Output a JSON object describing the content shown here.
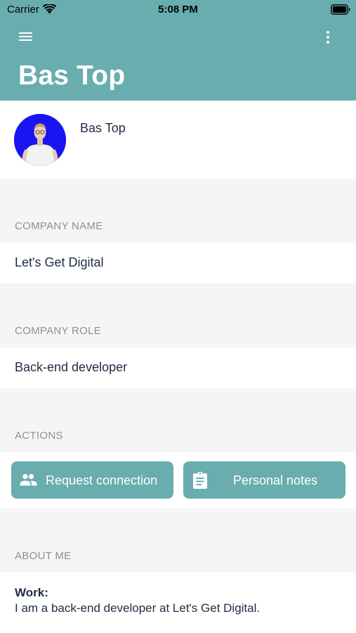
{
  "status_bar": {
    "carrier": "Carrier",
    "time": "5:08 PM"
  },
  "header": {
    "title": "Bas Top",
    "menu_icon": "hamburger-menu-icon",
    "more_icon": "more-vertical-icon",
    "background_color": "#69adae"
  },
  "profile": {
    "name": "Bas Top",
    "avatar_background": "#1a13f2"
  },
  "sections": {
    "company_name": {
      "label": "COMPANY NAME",
      "value": "Let's Get Digital"
    },
    "company_role": {
      "label": "COMPANY ROLE",
      "value": "Back-end developer"
    },
    "actions": {
      "label": "ACTIONS",
      "request_connection": {
        "label": "Request connection",
        "icon": "people-icon"
      },
      "personal_notes": {
        "label": "Personal notes",
        "icon": "clipboard-icon"
      }
    },
    "about_me": {
      "label": "ABOUT ME",
      "heading": "Work:",
      "text": "I am a back-end developer at Let's Get Digital."
    }
  }
}
